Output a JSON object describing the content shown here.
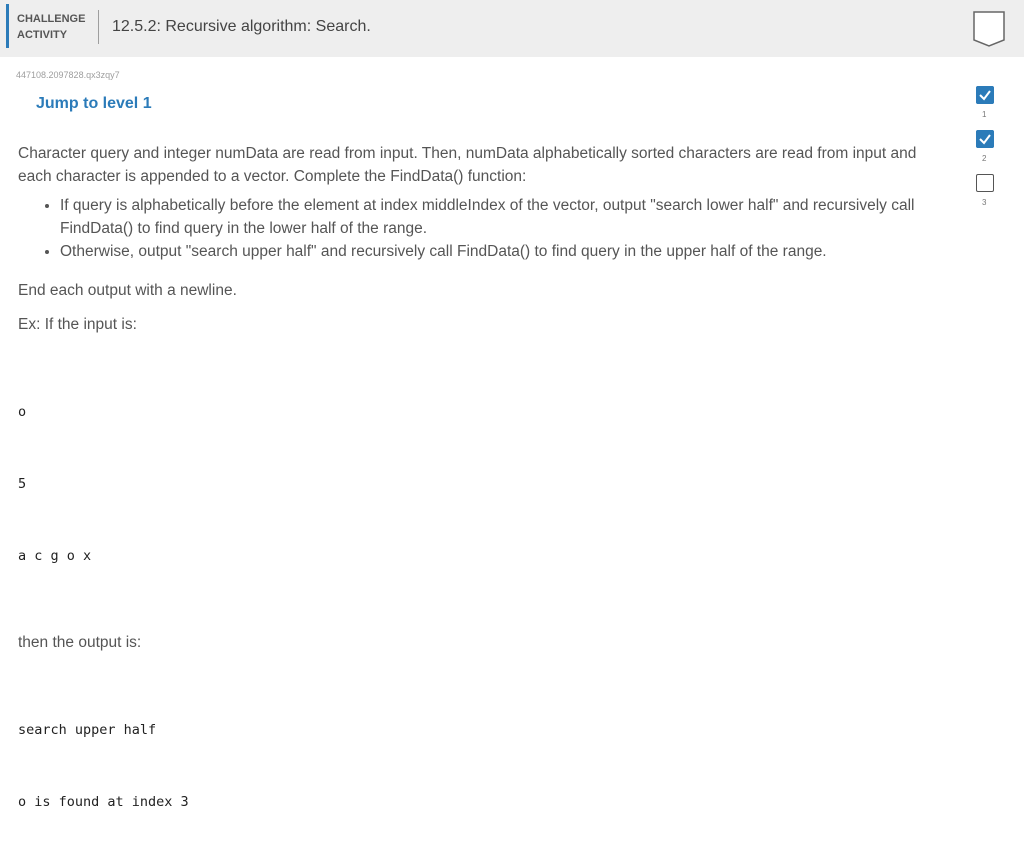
{
  "header": {
    "activity_label_line1": "CHALLENGE",
    "activity_label_line2": "ACTIVITY",
    "title": "12.5.2: Recursive algorithm: Search.",
    "bookmark_icon": "bookmark-icon"
  },
  "code_id": "447108.2097828.qx3zqy7",
  "jump_label": "Jump to level 1",
  "instructions": {
    "intro": "Character query and integer numData are read from input. Then, numData alphabetically sorted characters are read from input and each character is appended to a vector. Complete the FindData() function:",
    "bullets": [
      "If query is alphabetically before the element at index middleIndex of the vector, output \"search lower half\" and recursively call FindData() to find query in the lower half of the range.",
      "Otherwise, output \"search upper half\" and recursively call FindData() to find query in the upper half of the range."
    ],
    "end_note": "End each output with a newline.",
    "example_intro": "Ex: If the input is:",
    "input_lines": [
      "o",
      "5",
      "a c g o x"
    ],
    "output_intro": "then the output is:",
    "output_lines": [
      "search upper half",
      "o is found at index 3"
    ]
  },
  "levels": [
    {
      "number": "1",
      "status": "completed"
    },
    {
      "number": "2",
      "status": "completed"
    },
    {
      "number": "3",
      "status": "not-completed"
    }
  ],
  "colors": {
    "accent": "#2b7bb9",
    "header_bg": "#eeeeee"
  }
}
